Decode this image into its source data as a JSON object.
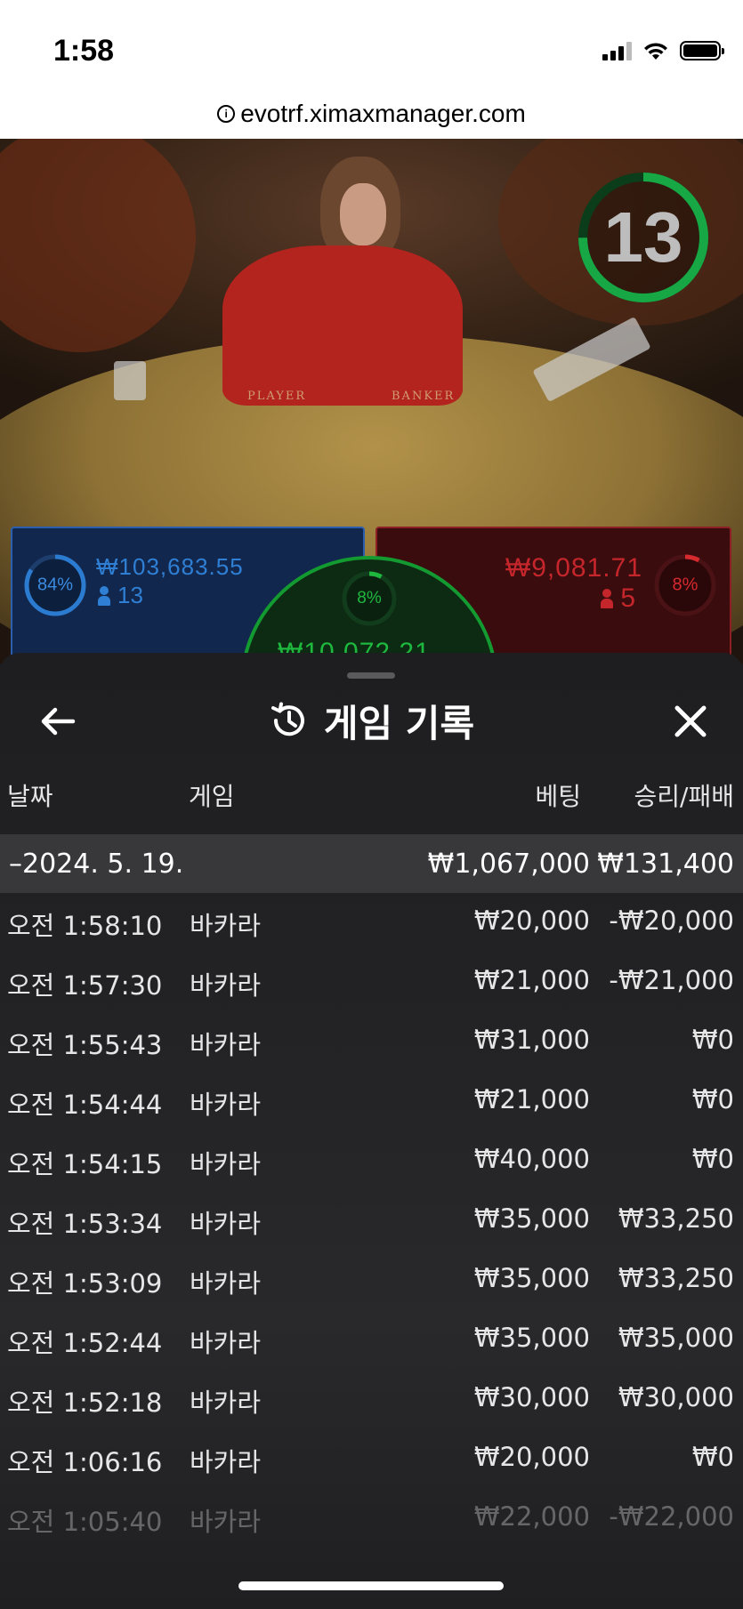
{
  "status_bar": {
    "time": "1:58"
  },
  "browser": {
    "url": "evotrf.ximaxmanager.com"
  },
  "video": {
    "timer": "13",
    "felt_left": "PLAYER",
    "felt_right": "BANKER"
  },
  "bets": {
    "player": {
      "pct_label": "84%",
      "pct": 0.84,
      "amount": "₩103,683.55",
      "players": "13",
      "color": "#2b7bd0"
    },
    "banker": {
      "pct_label": "8%",
      "pct": 0.08,
      "amount": "₩9,081.71",
      "players": "5",
      "color": "#d62a2f"
    },
    "tie": {
      "pct_label": "8%",
      "pct": 0.08,
      "amount_partial": "₩10,072.21",
      "color": "#1fb83f"
    }
  },
  "sheet": {
    "title": "게임 기록",
    "headers": {
      "date": "날짜",
      "game": "게임",
      "bet": "베팅",
      "winloss": "승리/패배"
    },
    "summary": {
      "date": "–2024. 5. 19.",
      "bet": "₩1,067,000",
      "winloss": "₩131,400"
    },
    "rows": [
      {
        "time": "오전 1:58:10",
        "game": "바카라",
        "bet": "₩20,000",
        "winloss": "-₩20,000"
      },
      {
        "time": "오전 1:57:30",
        "game": "바카라",
        "bet": "₩21,000",
        "winloss": "-₩21,000"
      },
      {
        "time": "오전 1:55:43",
        "game": "바카라",
        "bet": "₩31,000",
        "winloss": "₩0"
      },
      {
        "time": "오전 1:54:44",
        "game": "바카라",
        "bet": "₩21,000",
        "winloss": "₩0"
      },
      {
        "time": "오전 1:54:15",
        "game": "바카라",
        "bet": "₩40,000",
        "winloss": "₩0"
      },
      {
        "time": "오전 1:53:34",
        "game": "바카라",
        "bet": "₩35,000",
        "winloss": "₩33,250"
      },
      {
        "time": "오전 1:53:09",
        "game": "바카라",
        "bet": "₩35,000",
        "winloss": "₩33,250"
      },
      {
        "time": "오전 1:52:44",
        "game": "바카라",
        "bet": "₩35,000",
        "winloss": "₩35,000"
      },
      {
        "time": "오전 1:52:18",
        "game": "바카라",
        "bet": "₩30,000",
        "winloss": "₩30,000"
      },
      {
        "time": "오전 1:06:16",
        "game": "바카라",
        "bet": "₩20,000",
        "winloss": "₩0"
      },
      {
        "time": "오전 1:05:40",
        "game": "바카라",
        "bet": "₩22,000",
        "winloss": "-₩22,000"
      }
    ]
  },
  "icons": {
    "back": "arrow-left-icon",
    "history": "history-icon",
    "close": "close-icon",
    "person": "person-icon",
    "info": "info-icon",
    "signal": "cellular-signal-icon",
    "wifi": "wifi-icon",
    "battery": "battery-icon"
  }
}
